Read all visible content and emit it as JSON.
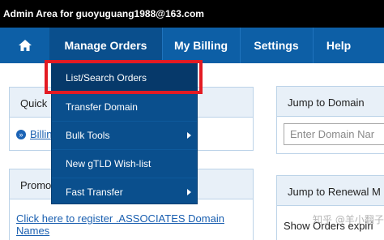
{
  "topbar": {
    "title": "Admin Area for guoyuguang1988@163.com"
  },
  "nav": {
    "home_icon": "home-icon",
    "manage_orders": "Manage Orders",
    "my_billing": "My Billing",
    "settings": "Settings",
    "help": "Help"
  },
  "dropdown": {
    "items": [
      {
        "label": "List/Search Orders",
        "submenu": false,
        "selected": true
      },
      {
        "label": "Transfer Domain",
        "submenu": false
      },
      {
        "label": "Bulk Tools",
        "submenu": true
      },
      {
        "label": "New gTLD Wish-list",
        "submenu": false
      },
      {
        "label": "Fast Transfer",
        "submenu": true
      }
    ]
  },
  "quick_panel": {
    "title": "Quick",
    "link": "Billin"
  },
  "promo_panel": {
    "title": "Promo",
    "link": "Click here to register .ASSOCIATES Domain Names"
  },
  "jump_panel": {
    "title": "Jump to Domain",
    "placeholder": "Enter Domain Nar"
  },
  "renewal_panel": {
    "title": "Jump to Renewal M",
    "text": "Show Orders expiri"
  },
  "watermark": "知乎 @羊小翻子",
  "colors": {
    "topbar": "#000000",
    "nav": "#0d5fa6",
    "nav_active": "#0a4f8d",
    "dropdown": "#0a4f8d",
    "highlight": "#e31b23",
    "link": "#1a5fb0",
    "panel_head": "#e8f0f8"
  }
}
